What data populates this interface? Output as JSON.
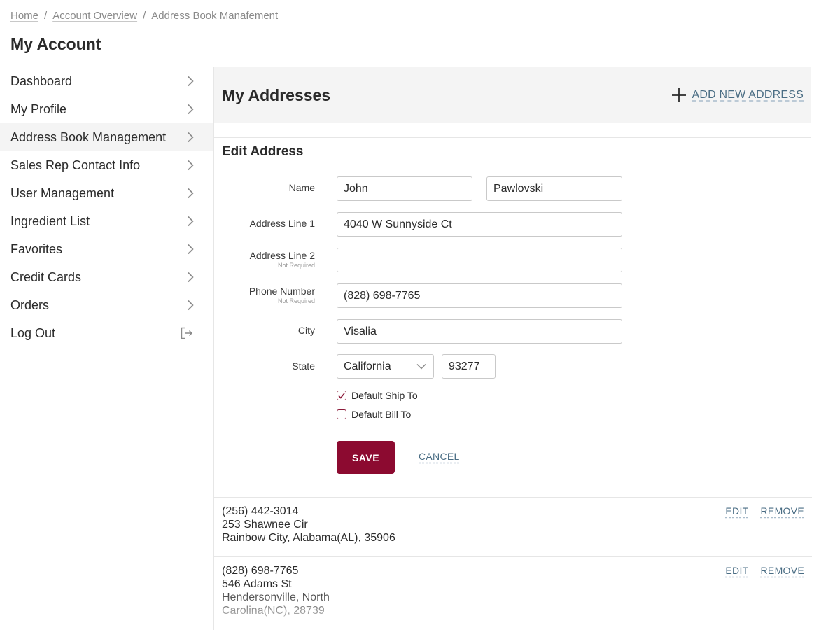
{
  "breadcrumb": {
    "items": [
      "Home",
      "Account Overview",
      "Address Book Manafement"
    ],
    "separator": "/"
  },
  "page_title": "My Account",
  "sidebar": {
    "items": [
      {
        "label": "Dashboard",
        "icon": "chevron-right-icon"
      },
      {
        "label": "My Profile",
        "icon": "chevron-right-icon"
      },
      {
        "label": "Address Book Management",
        "icon": "chevron-right-icon",
        "active": true
      },
      {
        "label": "Sales Rep Contact Info",
        "icon": "chevron-right-icon"
      },
      {
        "label": "User Management",
        "icon": "chevron-right-icon"
      },
      {
        "label": "Ingredient List",
        "icon": "chevron-right-icon"
      },
      {
        "label": "Favorites",
        "icon": "chevron-right-icon"
      },
      {
        "label": "Credit Cards",
        "icon": "chevron-right-icon"
      },
      {
        "label": "Orders",
        "icon": "chevron-right-icon"
      },
      {
        "label": "Log Out",
        "icon": "logout-icon"
      }
    ]
  },
  "main": {
    "title": "My Addresses",
    "add_label": "ADD NEW ADDRESS",
    "edit_title": "Edit Address",
    "form": {
      "name_label": "Name",
      "first_name": "John",
      "last_name": "Pawlovski",
      "address1_label": "Address Line 1",
      "address1": "4040 W Sunnyside Ct",
      "address2_label": "Address Line 2",
      "address2_note": "Not Required",
      "address2": "",
      "phone_label": "Phone Number",
      "phone_note": "Not Required",
      "phone": "(828) 698-7765",
      "city_label": "City",
      "city": "Visalia",
      "state_label": "State",
      "state": "California",
      "zip": "93277",
      "default_ship_label": "Default Ship To",
      "default_ship_checked": true,
      "default_bill_label": "Default Bill To",
      "default_bill_checked": false,
      "save_label": "SAVE",
      "cancel_label": "CANCEL"
    },
    "addresses": [
      {
        "phone": "(256) 442-3014",
        "line1": "253 Shawnee Cir",
        "line2": "Rainbow City, Alabama(AL), 35906",
        "edit": "EDIT",
        "remove": "REMOVE"
      },
      {
        "phone": "(828) 698-7765",
        "line1": "546 Adams St",
        "line2": "Hendersonville, North",
        "line3": "Carolina(NC), 28739",
        "edit": "EDIT",
        "remove": "REMOVE"
      }
    ]
  },
  "colors": {
    "accent": "#8c0a30",
    "link": "#4a6d84",
    "panel_bg": "#f4f4f4"
  }
}
